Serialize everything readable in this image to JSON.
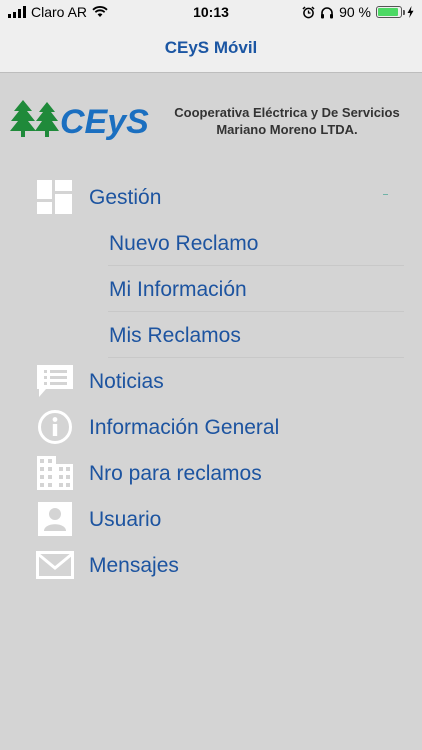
{
  "status": {
    "carrier": "Claro AR",
    "time": "10:13",
    "battery_text": "90 %",
    "battery_level": 0.9
  },
  "nav": {
    "title": "CEyS Móvil"
  },
  "logo": {
    "letters": "CEyS",
    "line1": "Cooperativa Eléctrica y De Servicios",
    "line2": "Mariano Moreno LTDA."
  },
  "menu": {
    "gestion": "Gestión",
    "nuevo_reclamo": "Nuevo Reclamo",
    "mi_informacion": "Mi Información",
    "mis_reclamos": "Mis Reclamos",
    "noticias": "Noticias",
    "informacion_general": "Información General",
    "nro_reclamos": "Nro para reclamos",
    "usuario": "Usuario",
    "mensajes": "Mensajes"
  },
  "colors": {
    "accent": "#1b56a3",
    "logo_green": "#1f8a3a",
    "logo_blue": "#1b6fc0",
    "icon_white": "#ffffff",
    "background": "#d4d4d4"
  },
  "icons": {
    "gestion": "dashboard-icon",
    "noticias": "news-chat-icon",
    "informacion_general": "info-icon",
    "nro_reclamos": "building-icon",
    "usuario": "user-icon",
    "mensajes": "mail-icon"
  }
}
